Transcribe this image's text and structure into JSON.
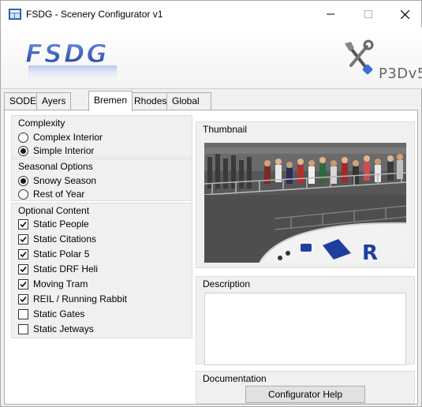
{
  "window": {
    "title": "FSDG - Scenery Configurator v1"
  },
  "banner": {
    "logo_text": "FSDG",
    "platform_text": "P3Dv5"
  },
  "tabs": [
    {
      "label": "SODE",
      "active": false
    },
    {
      "label": "Ayers Rock",
      "active": false
    },
    {
      "label": "Bremen",
      "active": true
    },
    {
      "label": "Rhodes",
      "active": false
    },
    {
      "label": "Global Settings",
      "active": false
    }
  ],
  "complexity": {
    "title": "Complexity",
    "options": [
      {
        "label": "Complex Interior",
        "selected": false
      },
      {
        "label": "Simple Interior",
        "selected": true
      }
    ]
  },
  "seasonal": {
    "title": "Seasonal Options",
    "options": [
      {
        "label": "Snowy Season",
        "selected": true
      },
      {
        "label": "Rest of Year",
        "selected": false
      }
    ]
  },
  "optional": {
    "title": "Optional Content",
    "items": [
      {
        "label": "Static People",
        "checked": true
      },
      {
        "label": "Static Citations",
        "checked": true
      },
      {
        "label": "Static Polar 5",
        "checked": true
      },
      {
        "label": "Static DRF Heli",
        "checked": true
      },
      {
        "label": "Moving Tram",
        "checked": true
      },
      {
        "label": "REIL / Running Rabbit",
        "checked": true
      },
      {
        "label": "Static Gates",
        "checked": false
      },
      {
        "label": "Static Jetways",
        "checked": false
      }
    ]
  },
  "thumbnail": {
    "title": "Thumbnail"
  },
  "description": {
    "title": "Description",
    "text": ""
  },
  "documentation": {
    "title": "Documentation",
    "button_label": "Configurator Help"
  },
  "colors": {
    "accent_blue": "#1f3fa0",
    "window_bg": "#f0f0f0",
    "border": "#adadad"
  }
}
